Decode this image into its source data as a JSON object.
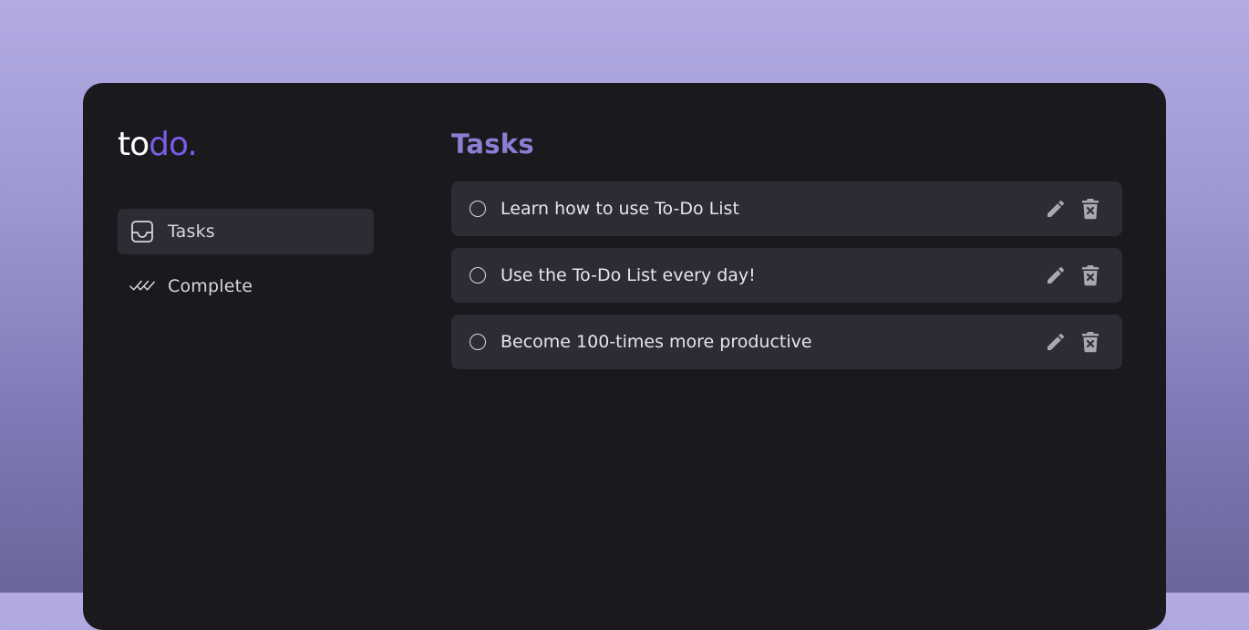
{
  "logo": {
    "part1": "to",
    "part2": "do."
  },
  "sidebar": {
    "items": [
      {
        "label": "Tasks",
        "icon": "inbox-icon",
        "active": true
      },
      {
        "label": "Complete",
        "icon": "double-check-icon",
        "active": false
      }
    ]
  },
  "main": {
    "title": "Tasks",
    "tasks": [
      {
        "text": "Learn how to use To-Do List",
        "done": false
      },
      {
        "text": "Use the To-Do List every day!",
        "done": false
      },
      {
        "text": "Become 100-times more productive",
        "done": false
      }
    ]
  },
  "colors": {
    "accent": "#7b5ce6",
    "title": "#8c7fd3",
    "panel": "#1a191e",
    "card": "#2d2c35"
  }
}
